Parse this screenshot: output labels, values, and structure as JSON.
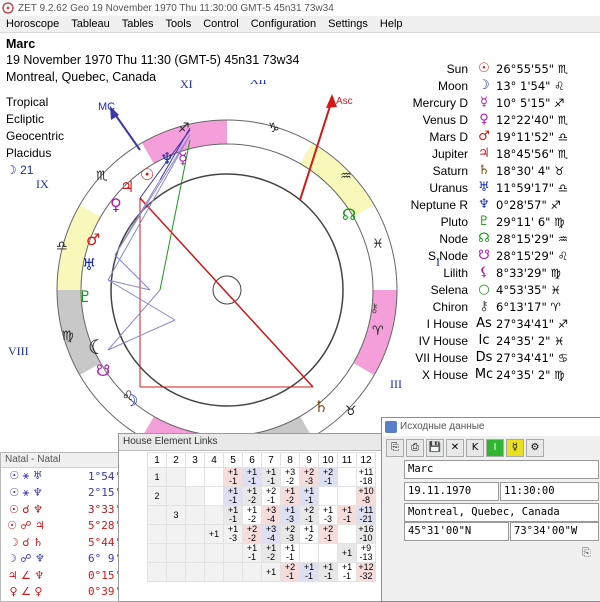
{
  "window": {
    "title": "ZET 9.2.62 Geo    19 November 1970  Thu  11:30:00 GMT-5 45n31  73w34",
    "menu": [
      "Horoscope",
      "Tableau",
      "Tables",
      "Tools",
      "Control",
      "Configuration",
      "Settings",
      "Help"
    ]
  },
  "chart_info": {
    "name": "Marc",
    "datetime": "19 November 1970  Thu  11:30 (GMT-5) 45n31  73w34",
    "place": "Montreal, Quebec, Canada",
    "options": [
      "Tropical",
      "Ecliptic",
      "Geocentric",
      "Placidus"
    ],
    "moon_day": "☽  21"
  },
  "wheel": {
    "house_labels": [
      "XI",
      "XII",
      "MC",
      "Asc",
      "IX",
      "II",
      "VIII",
      "III"
    ],
    "angle_labels": {
      "mc": "MC",
      "asc": "Asc"
    }
  },
  "planets": [
    {
      "name": "Sun",
      "symbol": "☉",
      "position": "26°55'55\" ♏",
      "color": "#d01818"
    },
    {
      "name": "Moon",
      "symbol": "☽",
      "position": "13° 1'54\" ♌",
      "color": "#1a2db0"
    },
    {
      "name": "Mercury D",
      "symbol": "☿",
      "position": "10° 5'15\" ♐",
      "color": "#b013b0"
    },
    {
      "name": "Venus D",
      "symbol": "♀",
      "position": "12°22'40\" ♏",
      "color": "#b013b0"
    },
    {
      "name": "Mars D",
      "symbol": "♂",
      "position": "19°11'52\" ♎",
      "color": "#d01818"
    },
    {
      "name": "Jupiter",
      "symbol": "♃",
      "position": "18°45'56\" ♏",
      "color": "#d01818"
    },
    {
      "name": "Saturn",
      "symbol": "♄",
      "position": "18°30' 4\" ♉",
      "color": "#7a4a10"
    },
    {
      "name": "Uranus",
      "symbol": "♅",
      "position": "11°59'17\" ♎",
      "color": "#1a2db0"
    },
    {
      "name": "Neptune R",
      "symbol": "♆",
      "position": "0°28'57\" ♐",
      "color": "#1a2db0"
    },
    {
      "name": "Pluto",
      "symbol": "♇",
      "position": "29°11' 6\" ♍",
      "color": "#149a14"
    },
    {
      "name": "Node",
      "symbol": "☊",
      "position": "28°15'29\" ♒",
      "color": "#149a14"
    },
    {
      "name": "S.Node",
      "symbol": "☋",
      "position": "28°15'29\" ♌",
      "color": "#b013b0"
    },
    {
      "name": "Lilith",
      "symbol": "⚸",
      "position": "8°33'29\" ♍",
      "color": "#b013b0"
    },
    {
      "name": "Selena",
      "symbol": "○",
      "position": "4°53'35\" ♓",
      "color": "#149a14"
    },
    {
      "name": "Chiron",
      "symbol": "⚷",
      "position": "6°13'17\" ♈",
      "color": "#555555"
    },
    {
      "name": "I House",
      "symbol": "As",
      "position": "27°34'41\" ♐",
      "color": "#000000"
    },
    {
      "name": "IV House",
      "symbol": "Ic",
      "position": "24°35' 2\" ♓",
      "color": "#000000"
    },
    {
      "name": "VII House",
      "symbol": "Ds",
      "position": "27°34'41\" ♋",
      "color": "#000000"
    },
    {
      "name": "X House",
      "symbol": "Mc",
      "position": "24°35' 2\" ♍",
      "color": "#000000"
    }
  ],
  "natal_panel": {
    "title": "Natal - Natal",
    "aspects": [
      {
        "symbols": "☉ ⚹ ♅",
        "value": "1°54' 2\"",
        "color": "#3838a8"
      },
      {
        "symbols": "☉ ⚹ ♆",
        "value": "2°15'12\"",
        "color": "#3838a8"
      },
      {
        "symbols": "☉ ☌ ♆",
        "value": "3°33' 2\"",
        "color": "#b01818"
      },
      {
        "symbols": "☉ ☍ ♃",
        "value": "5°28'10\"",
        "color": "#d01818"
      },
      {
        "symbols": "☽ ☌ ♄",
        "value": "5°44' 2\"",
        "color": "#d01818"
      },
      {
        "symbols": "☽ ☍ ♆",
        "value": "6° 9'58\"",
        "color": "#3838a8"
      },
      {
        "symbols": "♃ ∠ ♆",
        "value": "0°15'52\"",
        "color": "#d01818"
      },
      {
        "symbols": "♀ ∠ ♀",
        "value": "0°39'14\"",
        "color": "#d01818"
      }
    ]
  },
  "house_links": {
    "title": "House Element Links",
    "columns": [
      "1",
      "2",
      "3",
      "4",
      "5",
      "6",
      "7",
      "8",
      "9",
      "10",
      "11",
      "12"
    ],
    "rows": [
      [
        "1",
        "",
        "",
        "",
        "+1 -1",
        "+1 -1",
        "+1 -1",
        "+3 -2",
        "+2 -3",
        "+2 -1",
        "",
        "+11 -18"
      ],
      [
        "2",
        "",
        "",
        "",
        "+1 -1",
        "+1 -2",
        "+2 -1",
        "+1 -2",
        "+1 -1",
        "",
        "",
        "+10 -8"
      ],
      [
        "",
        "3",
        "",
        "",
        "+1 -1",
        "+1 -2",
        "+3 -4",
        "+1 -3",
        "+2 -1",
        "+1 -3",
        "+1 -1",
        "+11 -21"
      ],
      [
        "",
        "",
        "",
        "+1",
        "+1 -3",
        "+2 -2",
        "+3 -4",
        "+2 -3",
        "+1 -2",
        "+2 -1",
        "",
        "+16 -10"
      ],
      [
        "",
        "",
        "",
        "",
        "",
        "+1 -1",
        "+1 -2",
        "+1 -1",
        "",
        "",
        "+1",
        "+9 -13"
      ],
      [
        "",
        "",
        "",
        "",
        "",
        "",
        "+1",
        "+2 -1",
        "+1 -1",
        "+1 -1",
        "+1 -1",
        "+12 -32"
      ]
    ]
  },
  "input_dialog": {
    "title": "Исходные данные",
    "name": "Marc",
    "date": "19.11.1970",
    "time": "11:30:00",
    "place": "Montreal, Quebec, Canada",
    "latitude": "45°31'00\"N",
    "longitude": "73°34'00\"W",
    "toolbar": [
      "⎘",
      "⎙",
      "💾",
      "✕",
      "K",
      "I",
      "☿",
      "⚙"
    ]
  }
}
